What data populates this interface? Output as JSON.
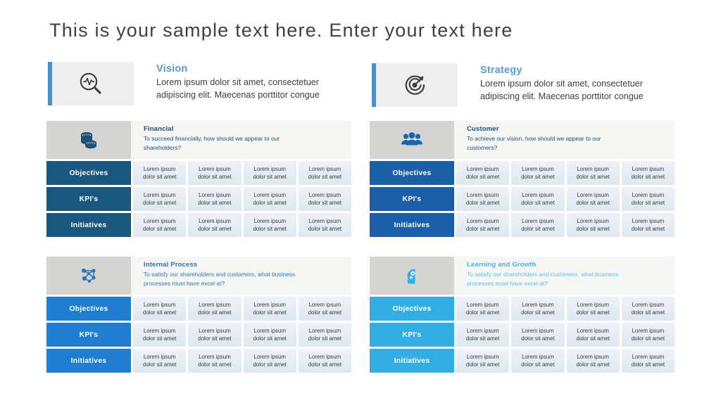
{
  "slide": {
    "title": "This is your sample text here. Enter your text here"
  },
  "banners": [
    {
      "id": "vision",
      "icon": "magnifier-pulse-icon",
      "title": "Vision",
      "desc_line1": "Lorem ipsum dolor sit amet, consectetuer",
      "desc_line2": "adipiscing elit. Maecenas porttitor congue",
      "accent_color": "#4a90cf",
      "title_color": "#5b9bd5"
    },
    {
      "id": "strategy",
      "icon": "target-arrow-icon",
      "title": "Strategy",
      "desc_line1": "Lorem ipsum dolor sit amet, consectetuer",
      "desc_line2": "adipiscing elit. Maecenas porttitor congue",
      "accent_color": "#4a90cf",
      "title_color": "#5b9bd5"
    }
  ],
  "row_labels": [
    "Objectives",
    "KPI's",
    "Initiatives"
  ],
  "cell_text_line1": "Lorem ipsum",
  "cell_text_line2": "dolor sit amet",
  "quadrants": [
    {
      "id": "financial",
      "icon": "coins-stack-icon",
      "title": "Financial",
      "desc_line1": "To succeed financially, how should  we appear to our",
      "desc_line2": "shareholders?",
      "label_color": "#19577d",
      "title_color": "#1f4e79",
      "desc_color": "#1f4e79",
      "icon_color": "#1f4e79"
    },
    {
      "id": "customer",
      "icon": "people-group-icon",
      "title": "Customer",
      "desc_line1": "To achieve our vision, how should  we appear to our",
      "desc_line2": "customers?",
      "label_color": "#1a5fa8",
      "title_color": "#1f4e79",
      "desc_color": "#1f4e79",
      "icon_color": "#1565b0"
    },
    {
      "id": "internal-process",
      "icon": "network-nodes-icon",
      "title": "Internal Process",
      "desc_line1": "To satisfy our shareholders and customers, what business",
      "desc_line2": "processes must have excel at?",
      "label_color": "#1f7ed0",
      "title_color": "#2e75b6",
      "desc_color": "#2e75b6",
      "icon_color": "#2e75b6"
    },
    {
      "id": "learning-growth",
      "icon": "head-gears-icon",
      "title": "Learning and Growth",
      "desc_line1": "To satisfy our shareholders and customers, what business",
      "desc_line2": "processes must have excel at?",
      "label_color": "#33aee3",
      "title_color": "#48b4e0",
      "desc_color": "#5fc0e6",
      "icon_color": "#31b0e5"
    }
  ]
}
